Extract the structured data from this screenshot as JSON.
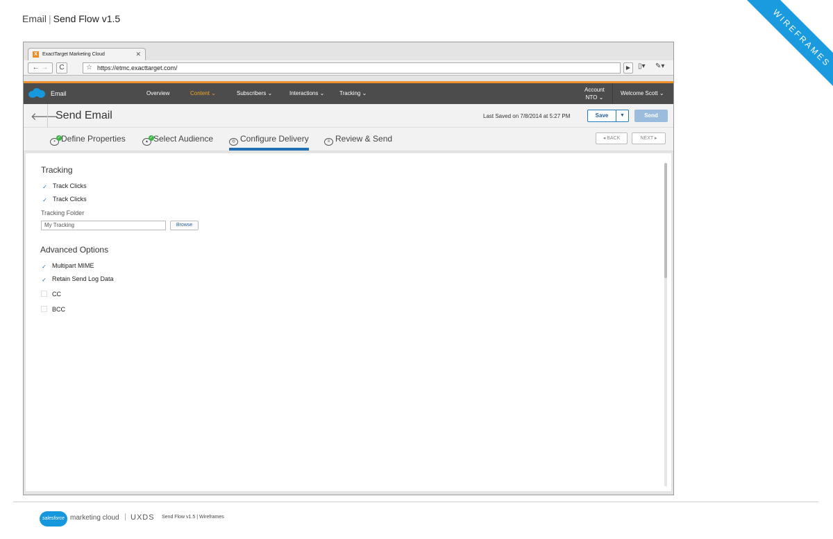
{
  "doc": {
    "section": "Email",
    "separator": "|",
    "title": "Send Flow v1.5"
  },
  "ribbon": {
    "label": "WIREFRAMES"
  },
  "browser": {
    "tab_title": "ExactTarget Marketing Cloud",
    "tab_favicon": "X",
    "tab_close": "✕",
    "url": "https://etmc.exacttarget.com/"
  },
  "appnav": {
    "app_name": "Email",
    "items": [
      "Overview",
      "Content ⌄",
      "Subscribers ⌄",
      "Interactions ⌄",
      "Tracking ⌄"
    ],
    "account_label": "Account",
    "account_value": "NTO ⌄",
    "welcome": "Welcome  Scott ⌄"
  },
  "titlebar": {
    "title": "Send Email",
    "last_saved": "Last Saved on 7/8/2014 at 5:27 PM",
    "save": "Save",
    "send": "Send"
  },
  "steps": {
    "items": [
      "Define Properties",
      "Select Audience",
      "Configure Delivery",
      "Review & Send"
    ],
    "active": "Configure Delivery",
    "back": "◂ BACK",
    "next": "NEXT ▸"
  },
  "tracking": {
    "heading": "Tracking",
    "checkboxes": [
      {
        "label": "Track Clicks",
        "checked": true
      },
      {
        "label": "Track Clicks",
        "checked": true
      }
    ],
    "folder_label": "Tracking Folder",
    "folder_value": "My Tracking",
    "browse": "Browse"
  },
  "advanced": {
    "heading": "Advanced Options",
    "checkboxes": [
      {
        "label": "Multipart MIME",
        "checked": true
      },
      {
        "label": "Retain Send Log Data",
        "checked": true
      },
      {
        "label": "CC",
        "checked": false
      },
      {
        "label": "BCC",
        "checked": false
      }
    ]
  },
  "footer": {
    "logo_text": "salesforce",
    "product": "marketing cloud",
    "team": "UXDS",
    "meta": "Send Flow v1.5  |  Wireframes"
  },
  "colors": {
    "accent": "#f0912c",
    "brand": "#1798dc",
    "nav_bg": "#4c4c4c",
    "active_step": "#1f6fb6"
  }
}
